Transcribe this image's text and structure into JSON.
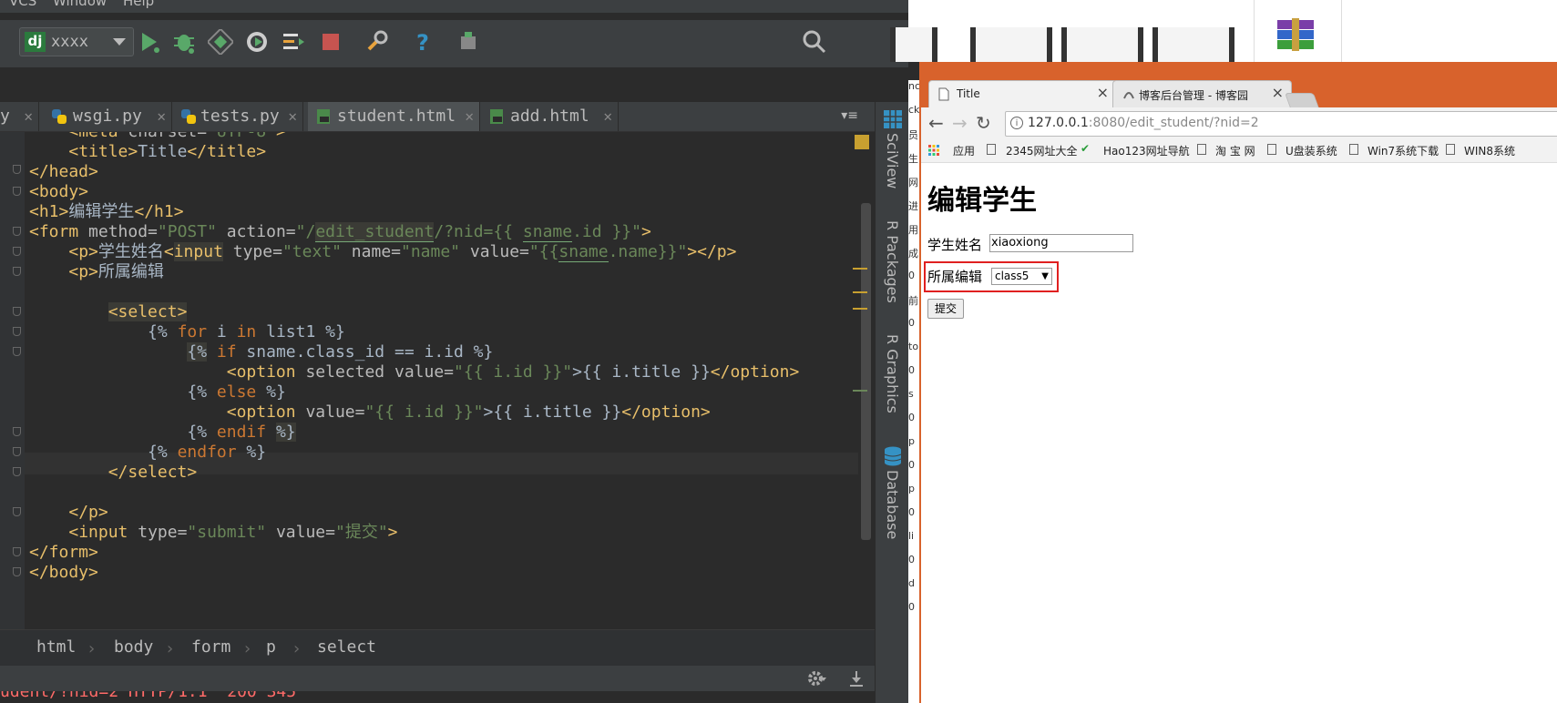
{
  "ide": {
    "menu": [
      "VCS",
      "Window",
      "Help"
    ],
    "run_config": "xxxx",
    "tabs": [
      {
        "label": "y"
      },
      {
        "label": "wsgi.py"
      },
      {
        "label": "tests.py"
      },
      {
        "label": "student.html"
      },
      {
        "label": "add.html"
      }
    ],
    "side_tools": [
      "SciView",
      "R Packages",
      "R Graphics",
      "Database"
    ],
    "breadcrumb": [
      "html",
      "body",
      "form",
      "p",
      "select"
    ],
    "console_line": "udent/?nid=2 HTTP/1.1\" 200 345",
    "code": [
      {
        "indent": "    ",
        "seg": [
          "<meta",
          " charset=",
          "\"UTF-8\"",
          ">"
        ]
      },
      {
        "indent": "    ",
        "seg": [
          "<title>",
          "Title",
          "</title>"
        ]
      },
      {
        "indent": "",
        "seg": [
          "</head>"
        ]
      },
      {
        "indent": "",
        "seg": [
          "<body>"
        ]
      },
      {
        "indent": "",
        "seg": [
          "<h1>",
          "编辑学生",
          "</h1>"
        ]
      },
      {
        "indent": "",
        "seg": [
          "<form",
          " method=",
          "\"POST\"",
          " action=",
          "\"/",
          "edit_student",
          "/?nid={{ ",
          "sname",
          ".id }}\"",
          ">"
        ]
      },
      {
        "indent": "    ",
        "seg": [
          "<p>",
          "学生姓名",
          "<",
          "input",
          " type=",
          "\"text\"",
          " name=",
          "\"name\"",
          " value=",
          "\"{{",
          "sname",
          ".name}}\"",
          "></p>"
        ]
      },
      {
        "indent": "    ",
        "seg": [
          "<p>",
          "所属编辑"
        ]
      },
      {
        "indent": "",
        "seg": [
          ""
        ]
      },
      {
        "indent": "        ",
        "seg": [
          "<",
          "select",
          ">"
        ]
      },
      {
        "indent": "            ",
        "seg": [
          "{% ",
          "for",
          " i ",
          "in",
          " list1 %}"
        ]
      },
      {
        "indent": "                ",
        "seg": [
          "{%",
          " if",
          " sname.class_id == i.id %}"
        ]
      },
      {
        "indent": "                    ",
        "seg": [
          "<option",
          " selected",
          " value=",
          "\"{{ i.id }}\"",
          ">{{ i.title }}",
          "</option>"
        ]
      },
      {
        "indent": "                ",
        "seg": [
          "{% ",
          "else",
          " %}"
        ]
      },
      {
        "indent": "                    ",
        "seg": [
          "<option",
          " value=",
          "\"{{ i.id }}\"",
          ">{{ i.title }}",
          "</option>"
        ]
      },
      {
        "indent": "                ",
        "seg": [
          "{% ",
          "endif",
          " ",
          "%}"
        ]
      },
      {
        "indent": "            ",
        "seg": [
          "{% ",
          "endfor",
          " %}"
        ]
      },
      {
        "indent": "        ",
        "seg": [
          "</select>"
        ]
      },
      {
        "indent": "",
        "seg": [
          ""
        ]
      },
      {
        "indent": "    ",
        "seg": [
          "</p>"
        ]
      },
      {
        "indent": "    ",
        "seg": [
          "<input",
          " type=",
          "\"submit\"",
          " value=",
          "\"提交\"",
          ">"
        ]
      },
      {
        "indent": "",
        "seg": [
          "</form>"
        ]
      },
      {
        "indent": "",
        "seg": [
          "</body>"
        ]
      }
    ]
  },
  "browser": {
    "tabs": [
      {
        "label": "Title"
      },
      {
        "label": "博客后台管理 - 博客园"
      }
    ],
    "url": "127.0.0.1:8080/edit_student/?nid=2",
    "url_host": "127.0.0.1",
    "url_rest": ":8080/edit_student/?nid=2",
    "bookmarks": [
      "应用",
      "2345网址大全",
      "Hao123网址导航",
      "淘 宝 网",
      "U盘装系统",
      "Win7系统下载",
      "WIN8系统"
    ],
    "page": {
      "heading": "编辑学生",
      "name_label": "学生姓名",
      "name_value": "xiaoxiong",
      "class_label": "所属编辑",
      "class_selected": "class5",
      "submit_label": "提交"
    },
    "background_left_chars": [
      "nc",
      "ck",
      "员",
      "生",
      "网",
      "进",
      "用",
      "成",
      "0",
      "前",
      "0",
      "to",
      "0",
      "s",
      "0",
      "p",
      "0",
      "p",
      "0",
      "li",
      "0",
      "d",
      "0"
    ]
  },
  "colors": {
    "ide_bg": "#2b2b2b",
    "tag": "#e8bf6a",
    "string": "#6a8759",
    "keyword": "#cc7832",
    "browser_accent": "#d8622c",
    "highlight_border": "#e02020"
  }
}
